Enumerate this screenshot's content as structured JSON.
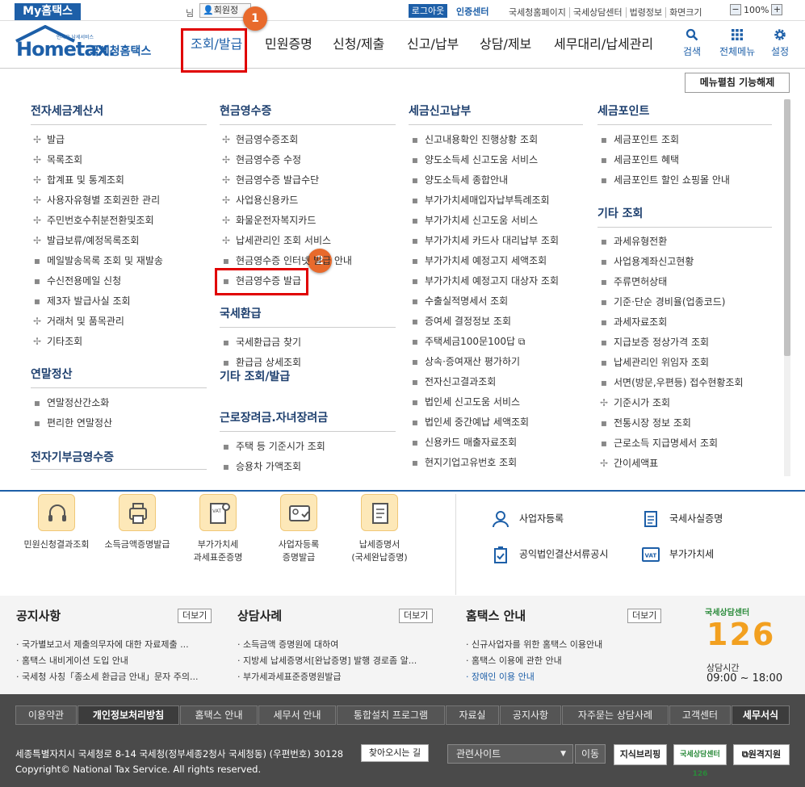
{
  "topbar": {
    "my_hometax": "My홈택스",
    "nim": "님",
    "member_info": "회원정",
    "logout": "로그아웃",
    "cert_center": "인증센터",
    "links": [
      "국세청홈페이지",
      "국세상담센터",
      "법령정보",
      "화면크기"
    ],
    "zoom_minus": "−",
    "zoom_value": "100%",
    "zoom_plus": "+"
  },
  "header": {
    "logo_tiny": "언제오 남세서비스",
    "logo_text": "Hometax.",
    "logo_sub": "국세청홈택스",
    "nav": [
      "조회/발급",
      "민원증명",
      "신청/제출",
      "신고/납부",
      "상담/제보",
      "세무대리/납세관리"
    ],
    "tools": [
      {
        "label": "검색",
        "icon": "search-icon"
      },
      {
        "label": "전체메뉴",
        "icon": "grid-icon"
      },
      {
        "label": "설정",
        "icon": "gear-icon"
      }
    ],
    "steps": [
      "1",
      "2"
    ]
  },
  "menu_toggle": "메뉴펼침 기능해제",
  "mega": {
    "col1": {
      "title": "전자세금계산서",
      "items": [
        "발급",
        "목록조회",
        "합계표 및 통계조회",
        "사용자유형별 조회권한 관리",
        "주민번호수취분전환및조회",
        "발급보류/예정목록조회",
        "메일발송목록 조회 및 재발송",
        "수신전용메일 신청",
        "제3자 발급사실 조회",
        "거래처 및 품목관리",
        "기타조회"
      ],
      "section2_title": "연말정산",
      "section2_items": [
        "연말정산간소화",
        "편리한 연말정산"
      ],
      "section3_title": "전자기부금영수증"
    },
    "col2": {
      "title": "현금영수증",
      "items": [
        "현금영수증조회",
        "현금영수증 수정",
        "현금영수증 발급수단",
        "사업용신용카드",
        "화물운전자복지카드",
        "납세관리인 조회 서비스",
        "현금영수증 인터넷 발급 안내",
        "현금영수증 발급"
      ],
      "section2_title": "국세환급",
      "section2_items": [
        "국세환급금 찾기",
        "환급금 상세조회"
      ],
      "section3_title": "기타 조회/발급",
      "section4_title": "근로장려금.자녀장려금",
      "section4_items": [
        "주택 등 기준시가 조회",
        "승용차 가액조회"
      ]
    },
    "col3": {
      "title": "세금신고납부",
      "items": [
        "신고내용확인 진행상황 조회",
        "양도소득세 신고도움 서비스",
        "양도소득세 종합안내",
        "부가가치세매입자납부특례조회",
        "부가가치세 신고도움 서비스",
        "부가가치세 카드사 대리납부 조회",
        "부가가치세 예정고지 세액조회",
        "부가가치세 예정고지 대상자 조회",
        "수출실적명세서 조회",
        "증여세 결정정보 조회",
        "주택세금100문100답",
        "상속·증여재산 평가하기",
        "전자신고결과조회",
        "법인세 신고도움 서비스",
        "법인세 중간예납 세액조회",
        "신용카드 매출자료조회",
        "현지기업고유번호 조회"
      ]
    },
    "col4": {
      "title": "세금포인트",
      "items": [
        "세금포인트 조회",
        "세금포인트 혜택",
        "세금포인트 할인 쇼핑몰 안내"
      ],
      "section2_title": "기타 조회",
      "section2_items": [
        "과세유형전환",
        "사업용계좌신고현황",
        "주류면허상태",
        "기준·단순 경비율(업종코드)",
        "과세자료조회",
        "지급보증 정상가격 조회",
        "납세관리인 위임자 조회",
        "서면(방문,우편등) 접수현황조회",
        "기준시가 조회",
        "전통시장 정보 조회",
        "근로소득 지급명세서 조회",
        "간이세액표"
      ]
    }
  },
  "quick": [
    {
      "label": "민원신청결과조회",
      "icon": "headset-icon"
    },
    {
      "label": "소득금액증명발급",
      "icon": "printer-icon"
    },
    {
      "label": "부가가치세\n과세표준증명",
      "icon": "vat-certificate-icon"
    },
    {
      "label": "사업자등록\n증명발급",
      "icon": "id-card-icon"
    },
    {
      "label": "납세증명서\n(국세완납증명)",
      "icon": "document-icon"
    }
  ],
  "right_links": [
    {
      "label": "사업자등록",
      "icon": "person-icon"
    },
    {
      "label": "국세사실증명",
      "icon": "file-icon"
    },
    {
      "label": "공익법인결산서류공시",
      "icon": "clipboard-icon"
    },
    {
      "label": "부가가치세",
      "icon": "vat-icon"
    }
  ],
  "notice": {
    "title": "공지사항",
    "more": "더보기",
    "items": [
      "국가별보고서 제출의무자에 대한 자료제출 ...",
      "홈택스 내비게이션 도입 안내",
      "국세청 사칭「종소세 환급금 안내」문자 주의..."
    ]
  },
  "consult": {
    "title": "상담사례",
    "more": "더보기",
    "items": [
      "소득금액 증명원에 대하여",
      "지방세 납세증명서[완납증명] 발행 경로좀 알...",
      "부가세과세표준증명원발급"
    ]
  },
  "guide": {
    "title": "홈택스 안내",
    "more": "더보기",
    "items": [
      "신규사업자를 위한 홈택스 이용안내",
      "홈택스 이용에 관한 안내",
      "장애인 이용 안내"
    ]
  },
  "center": {
    "top_text": "국세상담센터",
    "number": "126",
    "hours_label": "상담시간",
    "hours": "09:00 ~ 18:00"
  },
  "footer": {
    "nav": [
      "이용약관",
      "개인정보처리방침",
      "홈택스 안내",
      "세무서 안내",
      "통합설치 프로그램",
      "자료실",
      "공지사항",
      "자주묻는 상담사례",
      "고객센터",
      "세무서식"
    ],
    "address": "세종특별자치시 국세청로 8-14 국세청(정부세종2청사 국세청동) (우편번호) 30128",
    "find": "찾아오시는 길",
    "copyright": "Copyright© National Tax Service. All rights reserved.",
    "related_select": "관련사이트",
    "move": "이동",
    "badges": [
      "지식브리핑",
      "국세상담센터 126",
      "원격지원"
    ]
  },
  "colors": {
    "brand": "#1d5fa8",
    "highlight": "#e00000",
    "step_badge": "#e86a2c",
    "footer_bg": "#4a4a4a"
  }
}
